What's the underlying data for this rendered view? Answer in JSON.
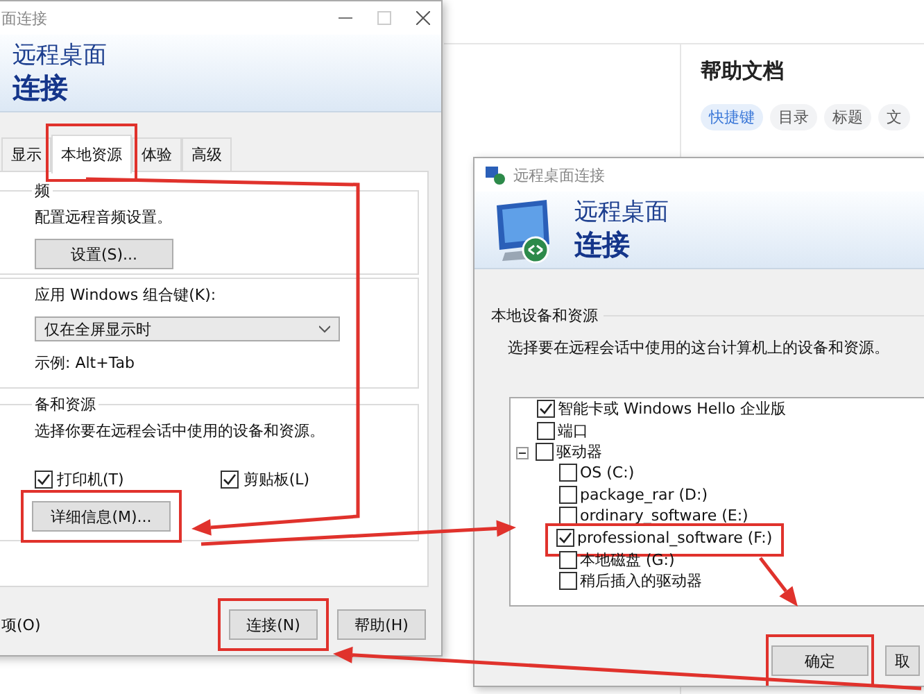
{
  "help_panel": {
    "title": "帮助文档",
    "tags": [
      {
        "label": "快捷键",
        "selected": true
      },
      {
        "label": "目录",
        "selected": false
      },
      {
        "label": "标题",
        "selected": false
      },
      {
        "label": "文",
        "selected": false
      }
    ]
  },
  "main_window": {
    "title": "面连接",
    "header_line1": "远程桌面",
    "header_line2": "连接",
    "tabs": [
      {
        "label": "显示",
        "selected": false,
        "highlighted": false
      },
      {
        "label": "本地资源",
        "selected": true,
        "highlighted": true
      },
      {
        "label": "体验",
        "selected": false,
        "highlighted": false
      },
      {
        "label": "高级",
        "selected": false,
        "highlighted": false
      }
    ],
    "audio_group": {
      "label": "频",
      "description": "配置远程音频设置。",
      "button": "设置(S)..."
    },
    "keyboard_group": {
      "label": "应用 Windows 组合键(K):",
      "dropdown_value": "仅在全屏显示时",
      "example": "示例: Alt+Tab"
    },
    "devices_group": {
      "label": "备和资源",
      "description": "选择你要在远程会话中使用的设备和资源。",
      "checkboxes": [
        {
          "label": "打印机(T)",
          "checked": true
        },
        {
          "label": "剪贴板(L)",
          "checked": true
        }
      ],
      "button": "详细信息(M)...",
      "button_highlighted": true
    },
    "options_link": "项(O)",
    "buttons": [
      {
        "label": "连接(N)",
        "highlighted": true
      },
      {
        "label": "帮助(H)",
        "highlighted": false
      }
    ]
  },
  "details_window": {
    "title": "远程桌面连接",
    "header_line1": "远程桌面",
    "header_line2": "连接",
    "section_label": "本地设备和资源",
    "description": "选择要在远程会话中使用的这台计算机上的设备和资源。",
    "tree": [
      {
        "label": "智能卡或 Windows Hello 企业版",
        "checked": true,
        "highlighted": false
      },
      {
        "label": "端口",
        "checked": false,
        "highlighted": false
      },
      {
        "label": "驱动器",
        "checked": false,
        "highlighted": false,
        "expanded": true,
        "children": [
          {
            "label": "OS (C:)",
            "checked": false,
            "highlighted": false
          },
          {
            "label": "package_rar (D:)",
            "checked": false,
            "highlighted": false
          },
          {
            "label": "ordinary_software (E:)",
            "checked": false,
            "highlighted": false
          },
          {
            "label": "professional_software (F:)",
            "checked": true,
            "highlighted": true
          },
          {
            "label": "本地磁盘 (G:)",
            "checked": false,
            "highlighted": false
          },
          {
            "label": "稍后插入的驱动器",
            "checked": false,
            "highlighted": false
          }
        ]
      }
    ],
    "buttons": [
      {
        "label": "确定",
        "highlighted": true
      },
      {
        "label": "取",
        "highlighted": false
      }
    ]
  }
}
